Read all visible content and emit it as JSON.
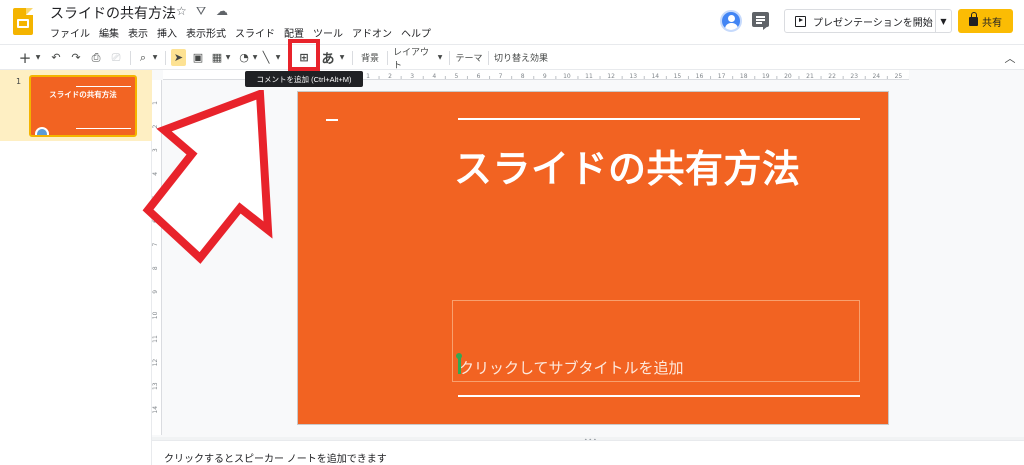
{
  "app": {
    "doc_title": "スライドの共有方法",
    "menu": [
      "ファイル",
      "編集",
      "表示",
      "挿入",
      "表示形式",
      "スライド",
      "配置",
      "ツール",
      "アドオン",
      "ヘルプ"
    ],
    "present_label": "プレゼンテーションを開始",
    "share_label": "共有"
  },
  "toolbar": {
    "background_label": "背景",
    "layout_label": "レイアウト",
    "theme_label": "テーマ",
    "transition_label": "切り替え効果",
    "text_input_label": "あ",
    "tooltip": "コメントを追加 (Ctrl+Alt+M)"
  },
  "filmstrip": {
    "slide_number": "1",
    "thumb_title": "スライドの共有方法"
  },
  "slide": {
    "title": "スライドの共有方法",
    "subtitle_placeholder": "クリックしてサブタイトルを追加"
  },
  "notes": {
    "placeholder": "クリックするとスピーカー ノートを追加できます"
  },
  "ruler": {
    "horizontal": [
      "1",
      "2",
      "3",
      "4",
      "5",
      "6",
      "7",
      "8",
      "9",
      "10",
      "11",
      "12",
      "13",
      "14",
      "15",
      "16",
      "17",
      "18",
      "19",
      "20",
      "21",
      "22",
      "23",
      "24",
      "25"
    ],
    "vertical": [
      "1",
      "2",
      "3",
      "4",
      "5",
      "6",
      "7",
      "8",
      "9",
      "10",
      "11",
      "12",
      "13",
      "14"
    ]
  },
  "colors": {
    "slide_bg": "#f26322",
    "accent_yellow": "#fbbc04",
    "highlight_red": "#e8232b"
  }
}
